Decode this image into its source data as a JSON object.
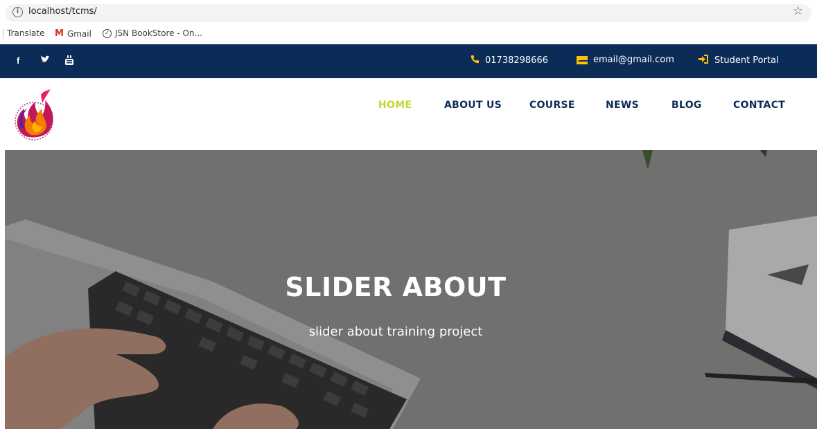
{
  "browser": {
    "url": "localhost/tcms/",
    "info_icon": "info-icon",
    "star_icon": "star-icon",
    "bookmarks": [
      {
        "label": "Translate",
        "icon": "none"
      },
      {
        "label": "Gmail",
        "icon": "gmail-icon"
      },
      {
        "label": "JSN BookStore - On...",
        "icon": "check-circle-icon"
      }
    ]
  },
  "topbar": {
    "background": "#0b2c56",
    "accent": "#ffc107",
    "social_icons": [
      "facebook-icon",
      "twitter-icon",
      "youtube-icon"
    ],
    "phone": "01738298666",
    "email": "email@gmail.com",
    "portal": "Student Portal"
  },
  "nav": {
    "items": [
      "HOME",
      "ABOUT US",
      "COURSE",
      "NEWS",
      "BLOG",
      "CONTACT"
    ],
    "active": "HOME",
    "active_color": "#c6d530",
    "color": "#0b2c56"
  },
  "hero": {
    "title": "SLIDER ABOUT",
    "subtitle": "slider about training project"
  }
}
